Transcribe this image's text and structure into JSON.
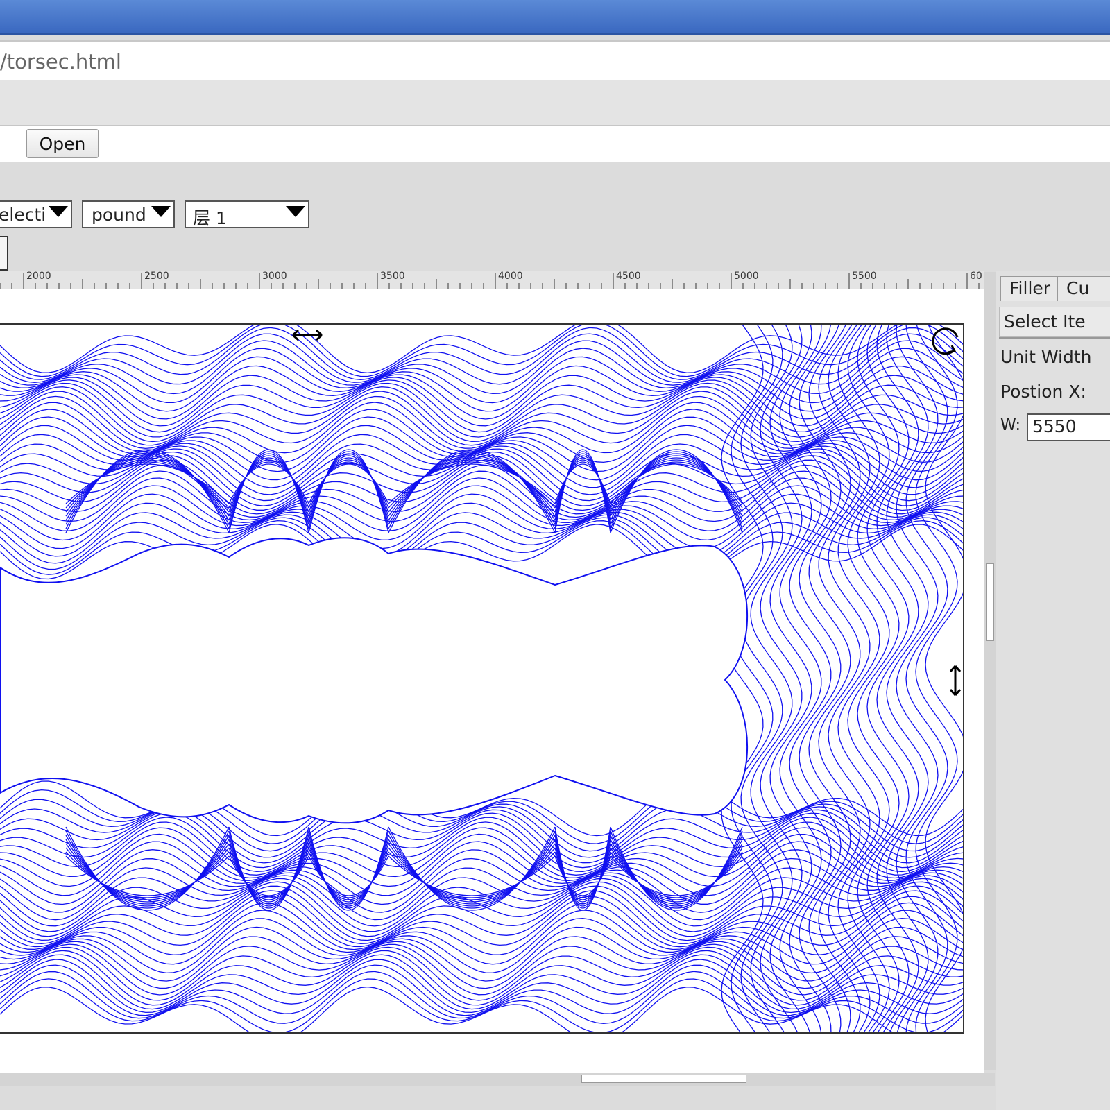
{
  "url": {
    "text": "/torsec.html"
  },
  "file_row": {
    "open_label": "Open"
  },
  "toolbar": {
    "selection_combo": "electi",
    "unit_combo": "pound",
    "layer_combo": "层 1"
  },
  "ruler": {
    "labels": [
      "2000",
      "2500",
      "3000",
      "3500",
      "4000",
      "4500",
      "5000",
      "5500",
      "60"
    ]
  },
  "panel": {
    "tabs": [
      "Filler",
      "Cu"
    ],
    "select_item": "Select Ite",
    "unit_width": "Unit Width",
    "position_x": "Postion X:",
    "w_label": "W:",
    "w_value": "5550"
  },
  "colors": {
    "pattern": "#1010f0",
    "title": "#4a78cc"
  }
}
